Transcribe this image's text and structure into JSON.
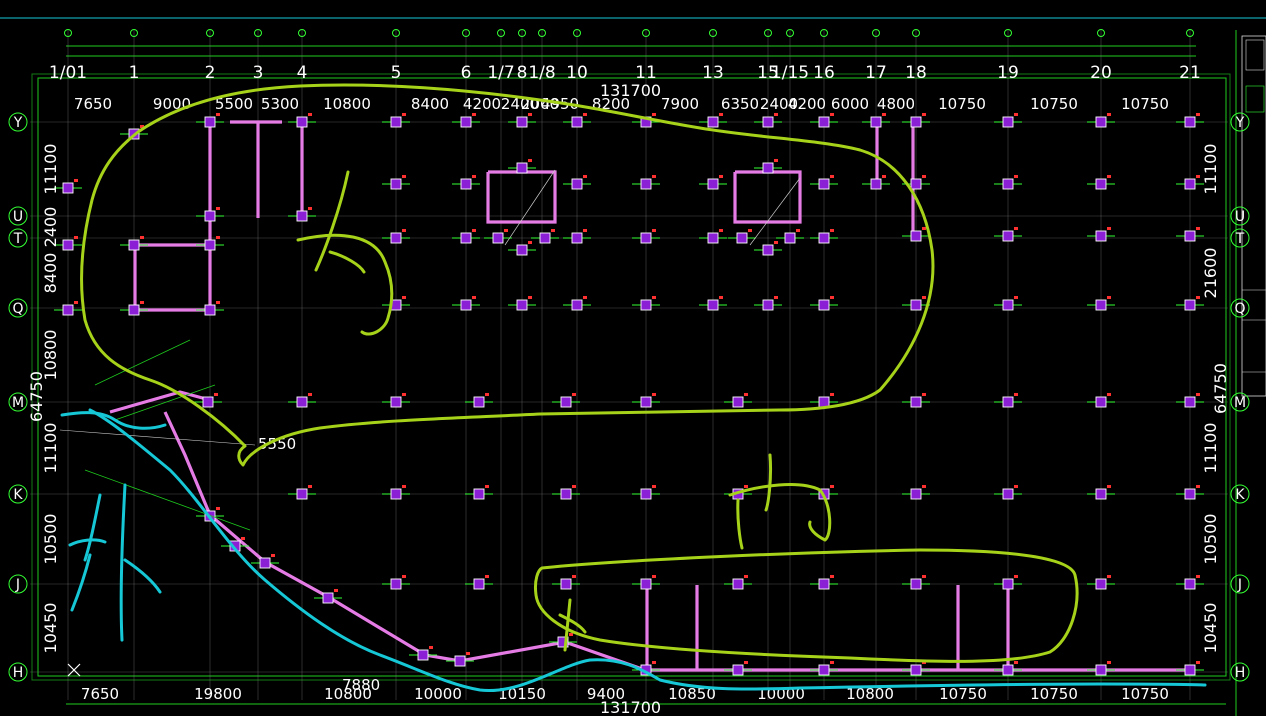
{
  "drawing": {
    "column_axes": [
      "1/01",
      "1",
      "2",
      "3",
      "4",
      "5",
      "6",
      "1/7",
      "8",
      "1/8",
      "10",
      "11",
      "13",
      "15",
      "1/15",
      "16",
      "17",
      "18",
      "19",
      "20",
      "21"
    ],
    "row_axes": [
      "Y",
      "U",
      "T",
      "Q",
      "M",
      "K",
      "J",
      "H"
    ],
    "top_spans": [
      "7650",
      "9000",
      "5500",
      "5300",
      "10800",
      "8400",
      "4200",
      "2400",
      "2000",
      "4950",
      "8200",
      "7900",
      "6350",
      "2400",
      "4200",
      "6000",
      "4800",
      "10750",
      "10750",
      "10750"
    ],
    "top_total": "131700",
    "bottom_spans": [
      "7650",
      "19800",
      "10800",
      "10000",
      "10150",
      "9400",
      "10850",
      "10000",
      "10800",
      "10750",
      "10750",
      "10750"
    ],
    "bottom_total": "131700",
    "bottom_note": "7880",
    "left_spans": [
      "11100",
      "2400",
      "8400",
      "10800",
      "11100",
      "10500",
      "10450"
    ],
    "left_total": "64750",
    "right_spans": [
      "11100",
      "21600",
      "11100",
      "10500",
      "10450"
    ],
    "right_total": "64750",
    "inner_dim": "5550",
    "colors": {
      "background": "#000000",
      "grid": "#8a8a8a",
      "column": "#8b1fd6",
      "beam": "#e57be5",
      "frame": "#1ecb1e",
      "sketch_green": "#a6d21a",
      "sketch_cyan": "#16c7d6"
    }
  }
}
